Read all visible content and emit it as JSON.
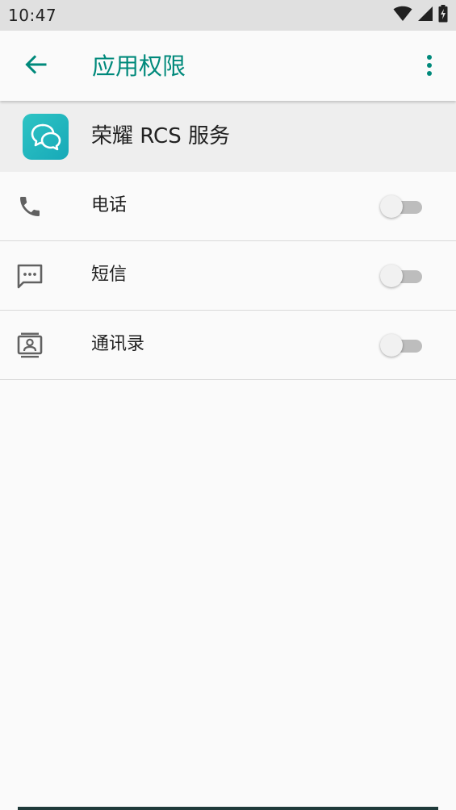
{
  "status_bar": {
    "time": "10:47",
    "icons": [
      "wifi-icon",
      "cell-signal-icon",
      "battery-charging-icon"
    ]
  },
  "app_bar": {
    "back_icon": "arrow-back-icon",
    "title": "应用权限",
    "overflow_icon": "more-vert-icon",
    "accent_color": "#00897b"
  },
  "app_info": {
    "icon": "chat-bubbles-icon",
    "name": "荣耀 RCS 服务"
  },
  "permissions": [
    {
      "icon": "phone-icon",
      "label": "电话",
      "enabled": false
    },
    {
      "icon": "sms-icon",
      "label": "短信",
      "enabled": false
    },
    {
      "icon": "contacts-icon",
      "label": "通讯录",
      "enabled": false
    }
  ]
}
